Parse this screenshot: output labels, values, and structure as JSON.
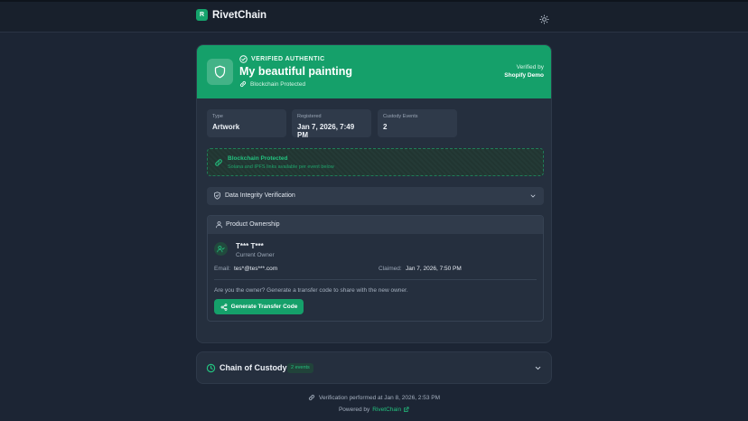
{
  "brand": {
    "mark": "R",
    "name": "RivetChain"
  },
  "header": {
    "theme_toggle_icon": "sun-icon"
  },
  "hero": {
    "badge": "VERIFIED AUTHENTIC",
    "title": "My beautiful painting",
    "protected_label": "Blockchain Protected",
    "verified_by_label": "Verified by",
    "verified_by_name": "Shopify Demo",
    "background": "#15a06a"
  },
  "stats": [
    {
      "label": "Type",
      "value": "Artwork"
    },
    {
      "label": "Registered",
      "value": "Jan 7, 2026, 7:49 PM"
    },
    {
      "label": "Custody Events",
      "value": "2"
    }
  ],
  "blockchain": {
    "title": "Blockchain Protected",
    "subtitle": "Solana and IPFS links available per event below"
  },
  "integrity": {
    "label": "Data Integrity Verification"
  },
  "ownership": {
    "header": "Product Ownership",
    "owner_name": "T*** T***",
    "owner_role": "Current Owner",
    "email_label": "Email:",
    "email_value": "tes*@tes***.com",
    "claimed_label": "Claimed:",
    "claimed_value": "Jan 7, 2026, 7:50 PM",
    "transfer_prompt": "Are you the owner? Generate a transfer code to share with the new owner.",
    "transfer_button": "Generate Transfer Code"
  },
  "custody": {
    "title": "Chain of Custody",
    "badge": "2 events"
  },
  "footer": {
    "verification": "Verification performed at Jan 8, 2026, 2:53 PM",
    "powered_by": "Powered by",
    "powered_link": "RivetChain"
  },
  "colors": {
    "accent": "#15a06a",
    "accent_text": "#23c27f",
    "page_bg": "#1c2534",
    "card_bg": "#252f3e"
  }
}
